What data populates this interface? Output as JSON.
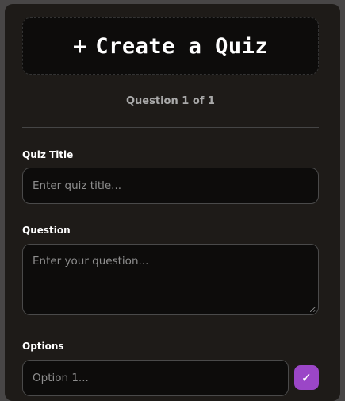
{
  "header": {
    "icon": "plus-icon",
    "plus_glyph": "+",
    "title": "Create a Quiz"
  },
  "counter": "Question 1 of 1",
  "quiz_title": {
    "label": "Quiz Title",
    "placeholder": "Enter quiz title...",
    "value": ""
  },
  "question": {
    "label": "Question",
    "placeholder": "Enter your question...",
    "value": ""
  },
  "options": {
    "label": "Options",
    "items": [
      {
        "placeholder": "Option 1...",
        "value": "",
        "correct": true,
        "check_glyph": "✓"
      }
    ]
  },
  "colors": {
    "accent": "#9b46c7",
    "card_background": "#1e1b18",
    "field_background": "#0d0c0b"
  }
}
